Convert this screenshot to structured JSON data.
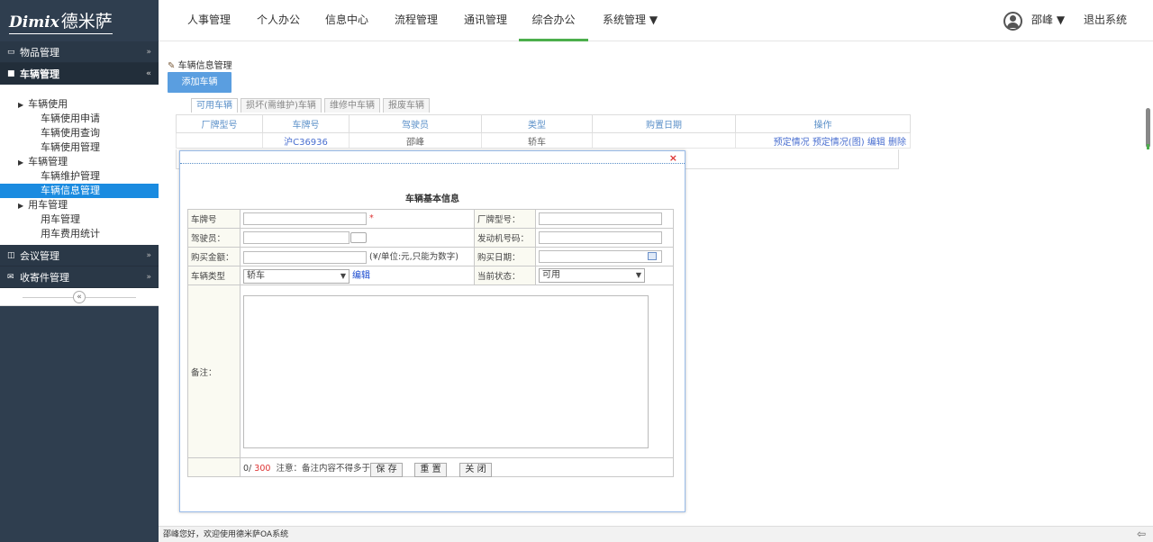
{
  "app": {
    "logo_en": "Dimix",
    "logo_cn": "德米萨"
  },
  "topnav": {
    "items": [
      "人事管理",
      "个人办公",
      "信息中心",
      "流程管理",
      "通讯管理",
      "综合办公",
      "系统管理 ▼"
    ],
    "user": "邵峰 ▼",
    "logout": "退出系统"
  },
  "sidebar": {
    "heads": [
      "物品管理",
      "车辆管理",
      "会议管理",
      "收寄件管理"
    ],
    "groups": [
      {
        "label": "车辆使用",
        "items": [
          "车辆使用申请",
          "车辆使用查询",
          "车辆使用管理"
        ]
      },
      {
        "label": "车辆管理",
        "items": [
          "车辆维护管理",
          "车辆信息管理"
        ]
      },
      {
        "label": "用车管理",
        "items": [
          "用车管理",
          "用车费用统计"
        ]
      }
    ],
    "collapse": "«"
  },
  "content": {
    "crumb": "车辆信息管理",
    "add_button": "添加车辆",
    "tabs": [
      "可用车辆",
      "损坏(需维护)车辆",
      "维修中车辆",
      "报废车辆"
    ],
    "columns": [
      "厂牌型号",
      "车牌号",
      "驾驶员",
      "类型",
      "购置日期",
      "操作"
    ],
    "rows": [
      {
        "model": "",
        "plate": "沪C36936",
        "driver": "邵峰",
        "type": "轿车",
        "date": "",
        "actions": [
          "预定情况",
          "预定情况(图)",
          "编辑",
          "删除"
        ]
      }
    ]
  },
  "dialog": {
    "close": "×",
    "title": "车辆基本信息",
    "labels": {
      "plate": "车牌号",
      "model": "厂牌型号：",
      "driver": "驾驶员：",
      "engine": "发动机号码：",
      "amount": "购买金额：",
      "amount_hint": "(¥/单位:元,只能为数字)",
      "buy_date": "购买日期：",
      "type": "车辆类型",
      "status": "当前状态：",
      "note": "备注：",
      "edit": "编辑",
      "star": "*"
    },
    "values": {
      "type": "轿车",
      "status": "可用"
    },
    "counter": {
      "current": "0/",
      "max": "300",
      "hint": "注意：备注内容不得多于300字"
    },
    "buttons": [
      "保 存",
      "重 置",
      "关 闭"
    ]
  },
  "footer": "邵峰您好，欢迎使用德米萨OA系统"
}
